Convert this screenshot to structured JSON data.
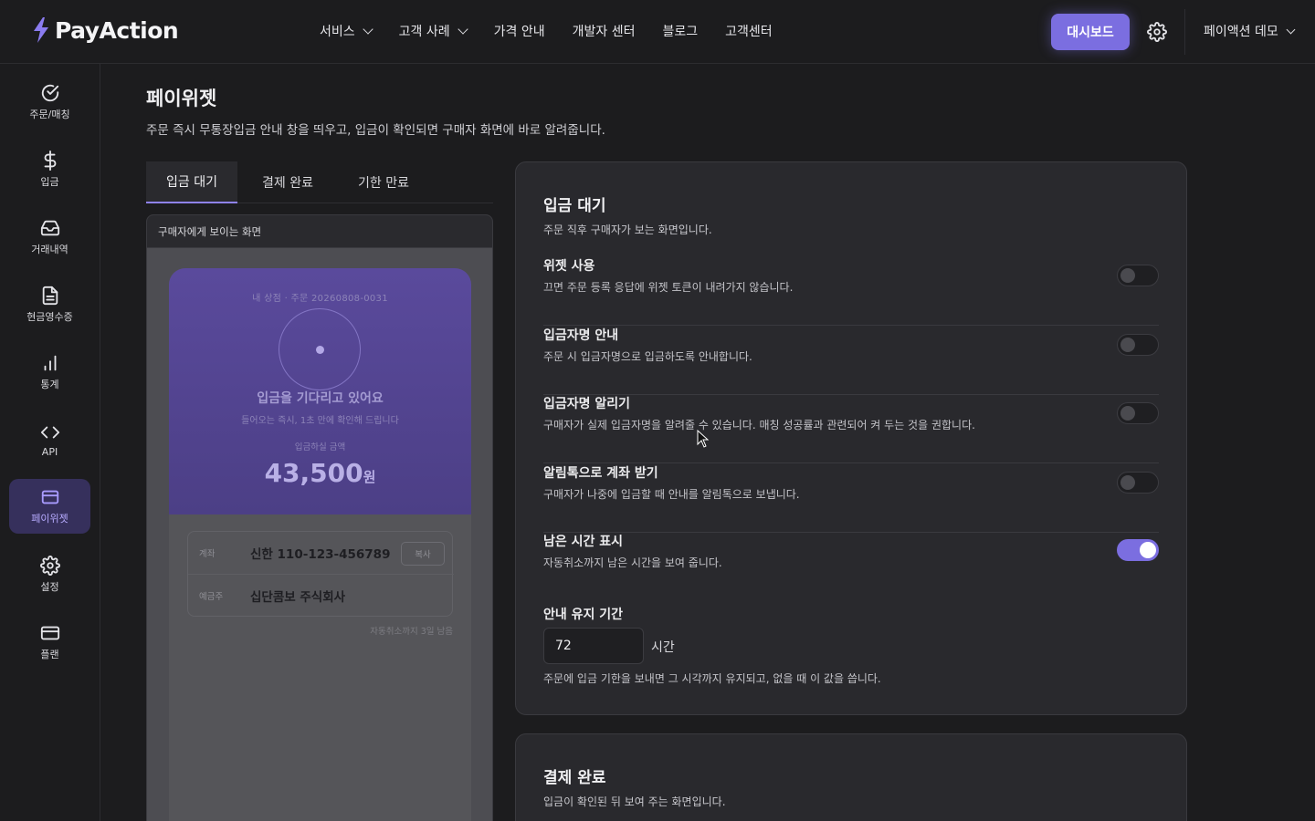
{
  "header": {
    "brand": "PayAction",
    "nav": [
      {
        "label": "서비스",
        "has_dropdown": true
      },
      {
        "label": "고객 사례",
        "has_dropdown": true
      },
      {
        "label": "가격 안내",
        "has_dropdown": false
      },
      {
        "label": "개발자 센터",
        "has_dropdown": false
      },
      {
        "label": "블로그",
        "has_dropdown": false
      },
      {
        "label": "고객센터",
        "has_dropdown": false
      }
    ],
    "dashboard_label": "대시보드",
    "user_label": "페이액션 데모"
  },
  "sidebar": {
    "items": [
      {
        "label": "주문/매칭",
        "icon": "check-circle-icon"
      },
      {
        "label": "입금",
        "icon": "dollar-icon"
      },
      {
        "label": "거래내역",
        "icon": "inbox-icon"
      },
      {
        "label": "현금영수증",
        "icon": "document-icon"
      },
      {
        "label": "통계",
        "icon": "bar-chart-icon"
      },
      {
        "label": "API",
        "icon": "code-icon"
      },
      {
        "label": "페이위젯",
        "icon": "card-icon",
        "active": true
      },
      {
        "label": "설정",
        "icon": "gear-icon"
      },
      {
        "label": "플랜",
        "icon": "credit-card-icon"
      }
    ]
  },
  "page": {
    "title": "페이위젯",
    "description": "주문 즉시 무통장입금 안내 창을 띄우고, 입금이 확인되면 구매자 화면에 바로 알려줍니다."
  },
  "tabs": [
    {
      "label": "입금 대기",
      "active": true
    },
    {
      "label": "결제 완료",
      "active": false
    },
    {
      "label": "기한 만료",
      "active": false
    }
  ],
  "preview": {
    "header": "구매자에게 보이는 화면",
    "order_line": "내 상점 · 주문 20260808-0031",
    "wait_title": "입금을 기다리고 있어요",
    "wait_sub": "들어오는 즉시, 1초 만에 확인해 드립니다",
    "amount_label": "입금하실 금액",
    "amount": "43,500",
    "currency": "원",
    "account_key": "계좌",
    "account_value": "신한 110-123-456789",
    "copy_label": "복사",
    "holder_key": "예금주",
    "holder_value": "십단콤보 주식회사",
    "auto_cancel": "자동취소까지 3일 남음"
  },
  "settings": {
    "title": "입금 대기",
    "subtitle": "주문 직후 구매자가 보는 화면입니다.",
    "rows": [
      {
        "label": "위젯 사용",
        "desc": "끄면 주문 등록 응답에 위젯 토큰이 내려가지 않습니다.",
        "enabled": false
      },
      {
        "label": "입금자명 안내",
        "desc": "주문 시 입금자명으로 입금하도록 안내합니다.",
        "enabled": false
      },
      {
        "label": "입금자명 알리기",
        "desc": "구매자가 실제 입금자명을 알려줄 수 있습니다. 매칭 성공률과 관련되어 켜 두는 것을 권합니다.",
        "enabled": false
      },
      {
        "label": "알림톡으로 계좌 받기",
        "desc": "구매자가 나중에 입금할 때 안내를 알림톡으로 보냅니다.",
        "enabled": false
      },
      {
        "label": "남은 시간 표시",
        "desc": "자동취소까지 남은 시간을 보여 줍니다.",
        "enabled": true
      }
    ],
    "keep_label": "안내 유지 기간",
    "keep_value": "72",
    "keep_unit": "시간",
    "keep_desc": "주문에 입금 기한을 보내면 그 시각까지 유지되고, 없을 때 이 값을 씁니다."
  },
  "settings2": {
    "title": "결제 완료",
    "subtitle": "입금이 확인된 뒤 보여 주는 화면입니다."
  },
  "colors": {
    "accent": "#7b6ee0",
    "background": "#1c1c1e",
    "card": "#29292d"
  }
}
